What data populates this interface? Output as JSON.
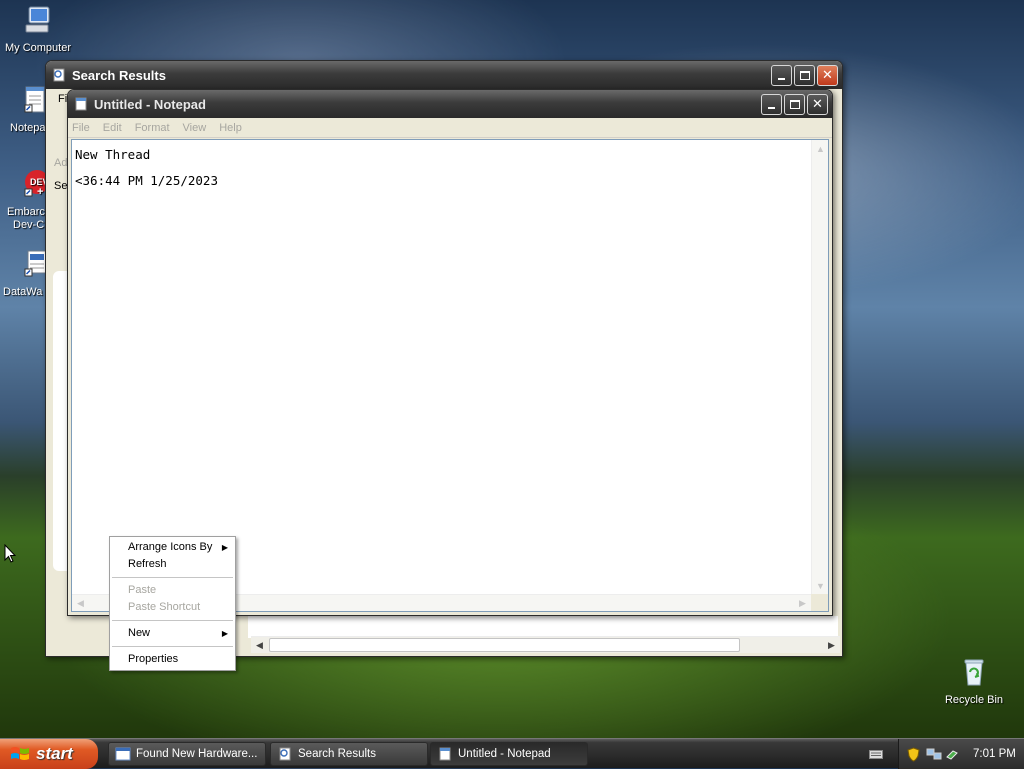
{
  "desktop": {
    "icons": [
      {
        "label": "My Computer"
      },
      {
        "label": "Notepa"
      },
      {
        "label": "Embarc"
      },
      {
        "label": "Dev-C"
      },
      {
        "label": "DataWa"
      },
      {
        "label": "Recycle Bin"
      }
    ]
  },
  "search_window": {
    "title": "Search Results",
    "menu_fragment": "Fi",
    "address_fragment": "Ad",
    "search_fragment": "Se"
  },
  "notepad": {
    "title": "Untitled - Notepad",
    "menu": [
      "File",
      "Edit",
      "Format",
      "View",
      "Help"
    ],
    "lines": [
      "New Thread",
      "<36:44 PM 1/25/2023"
    ]
  },
  "context_menu": {
    "arrange_icons_by": "Arrange Icons By",
    "refresh": "Refresh",
    "paste": "Paste",
    "paste_shortcut": "Paste Shortcut",
    "new": "New",
    "properties": "Properties"
  },
  "taskbar": {
    "start_label": "start",
    "buttons": [
      {
        "label": "Found New Hardware..."
      },
      {
        "label": "Search Results"
      },
      {
        "label": "Untitled - Notepad"
      }
    ],
    "clock": "7:01 PM"
  },
  "colors": {
    "title_bar": "#3b3b3b",
    "close_button": "#c0391b",
    "start_button": "#e05a24"
  }
}
